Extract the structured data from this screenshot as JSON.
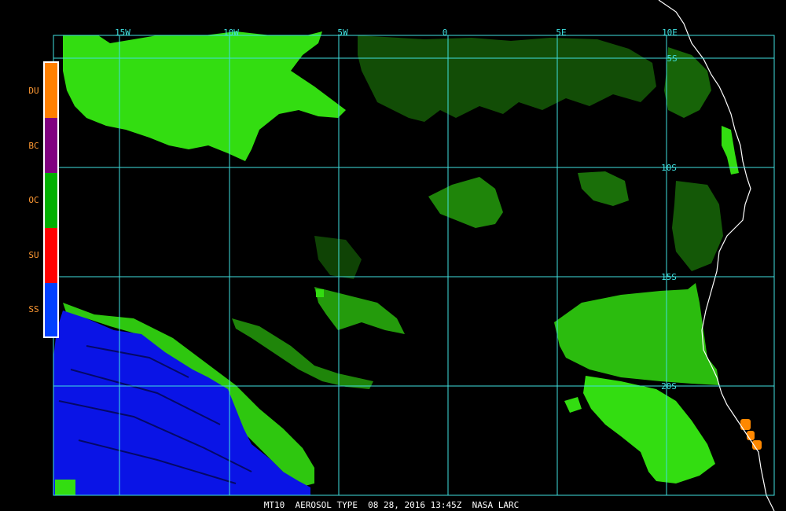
{
  "map": {
    "caption": "MT10  AEROSOL TYPE  08 28, 2016 13:45Z  NASA LARC",
    "gridline_color": "#40e0e0",
    "label_color": "#40e0e0",
    "caption_color": "#ffffff",
    "coastline_color": "#ffffff",
    "longitude_labels": [
      "15W",
      "10W",
      "5W",
      "0",
      "5E",
      "10E"
    ],
    "latitude_labels": [
      "5S",
      "10S",
      "15S",
      "20S"
    ]
  },
  "legend": {
    "label_color": "#ff9933",
    "items": [
      {
        "code": "DU",
        "color": "#ff8000"
      },
      {
        "code": "BC",
        "color": "#800080"
      },
      {
        "code": "OC",
        "color": "#00b000"
      },
      {
        "code": "SU",
        "color": "#ff0000"
      },
      {
        "code": "SS",
        "color": "#0040ff"
      }
    ]
  },
  "aerosol_colors": {
    "oc": "#33dd11",
    "ss": "#0a14e6",
    "du": "#ff8800"
  }
}
